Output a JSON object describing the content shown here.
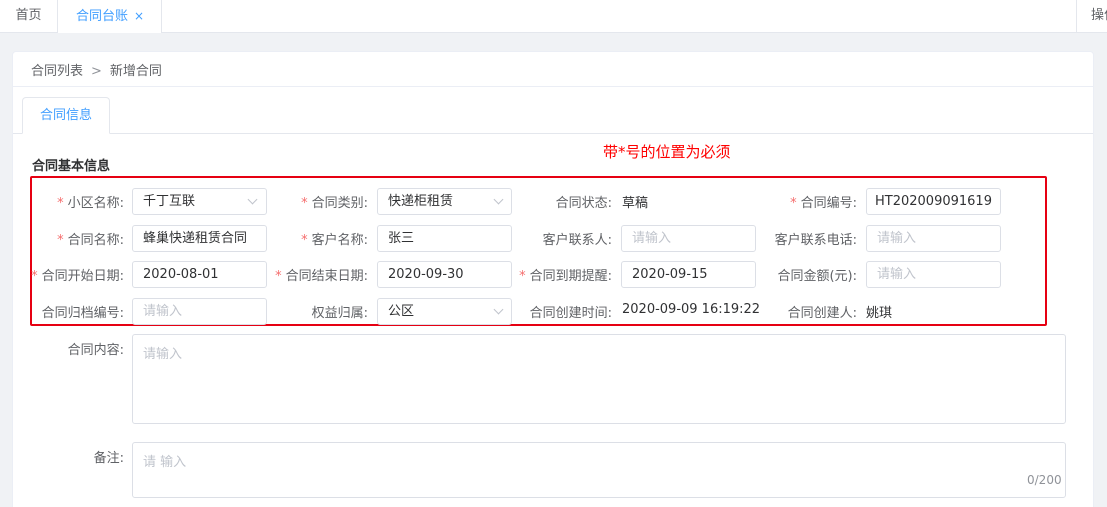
{
  "tabs": {
    "home": "首页",
    "ledger": "合同台账",
    "close": "×",
    "right": "操作"
  },
  "breadcrumb": {
    "list": "合同列表",
    "sep": ">",
    "current": "新增合同"
  },
  "inner_tab": "合同信息",
  "section_title": "合同基本信息",
  "notice": "带*号的位置为必须",
  "required_mark": "*",
  "form": {
    "community": {
      "label": "小区名称:",
      "value": "千丁互联"
    },
    "type": {
      "label": "合同类别:",
      "value": "快递柜租赁"
    },
    "status": {
      "label": "合同状态:",
      "value": "草稿"
    },
    "number": {
      "label": "合同编号:",
      "value": "HT202009091619"
    },
    "name": {
      "label": "合同名称:",
      "value": "蜂巢快递租赁合同"
    },
    "customer": {
      "label": "客户名称:",
      "value": "张三"
    },
    "contact": {
      "label": "客户联系人:",
      "placeholder": "请输入"
    },
    "phone": {
      "label": "客户联系电话:",
      "placeholder": "请输入"
    },
    "start_date": {
      "label": "合同开始日期:",
      "value": "2020-08-01"
    },
    "end_date": {
      "label": "合同结束日期:",
      "value": "2020-09-30"
    },
    "reminder": {
      "label": "合同到期提醒:",
      "value": "2020-09-15"
    },
    "amount": {
      "label": "合同金额(元):",
      "placeholder": "请输入"
    },
    "archive": {
      "label": "合同归档编号:",
      "placeholder": "请输入"
    },
    "rights": {
      "label": "权益归属:",
      "value": "公区"
    },
    "created_time": {
      "label": "合同创建时间:",
      "value": "2020-09-09 16:19:22"
    },
    "creator": {
      "label": "合同创建人:",
      "value": "姚琪"
    },
    "content": {
      "label": "合同内容:",
      "placeholder": "请输入"
    },
    "remark": {
      "label": "备注:",
      "placeholder": "请 输入",
      "counter": "0/200"
    }
  }
}
